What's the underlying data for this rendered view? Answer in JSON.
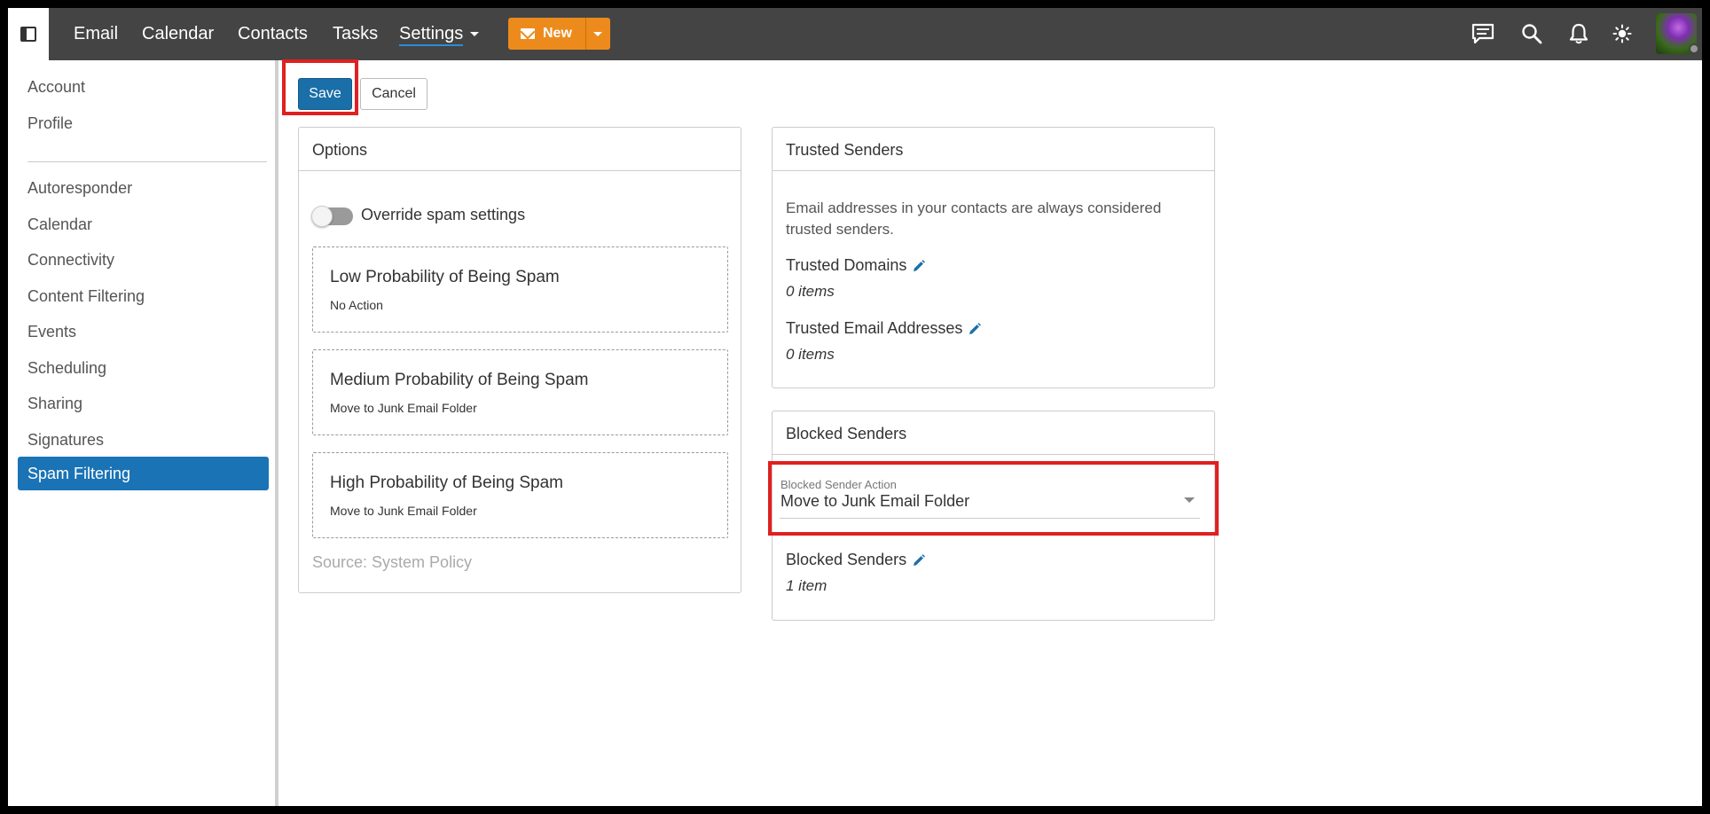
{
  "nav": {
    "items": [
      "Email",
      "Calendar",
      "Contacts",
      "Tasks"
    ],
    "settings": "Settings",
    "new_label": "New"
  },
  "sidebar": {
    "items": [
      "Account",
      "Profile",
      "Autoresponder",
      "Calendar",
      "Connectivity",
      "Content Filtering",
      "Events",
      "Scheduling",
      "Sharing",
      "Signatures"
    ],
    "active": "Spam Filtering"
  },
  "toolbar": {
    "save": "Save",
    "cancel": "Cancel"
  },
  "options": {
    "title": "Options",
    "override_label": "Override spam settings",
    "override_on": false,
    "levels": [
      {
        "title": "Low Probability of Being Spam",
        "action": "No Action"
      },
      {
        "title": "Medium Probability of Being Spam",
        "action": "Move to Junk Email Folder"
      },
      {
        "title": "High Probability of Being Spam",
        "action": "Move to Junk Email Folder"
      }
    ],
    "source": "Source: System Policy"
  },
  "trusted": {
    "title": "Trusted Senders",
    "description": "Email addresses in your contacts are always considered trusted senders.",
    "domains_label": "Trusted Domains",
    "domains_count": "0 items",
    "emails_label": "Trusted Email Addresses",
    "emails_count": "0 items"
  },
  "blocked": {
    "title": "Blocked Senders",
    "action_label": "Blocked Sender Action",
    "action_value": "Move to Junk Email Folder",
    "senders_label": "Blocked Senders",
    "senders_count": "1 item"
  },
  "colors": {
    "topbar": "#444444",
    "accent": "#1a73b5",
    "new_button": "#ec8b1c",
    "highlight": "#e02020"
  }
}
